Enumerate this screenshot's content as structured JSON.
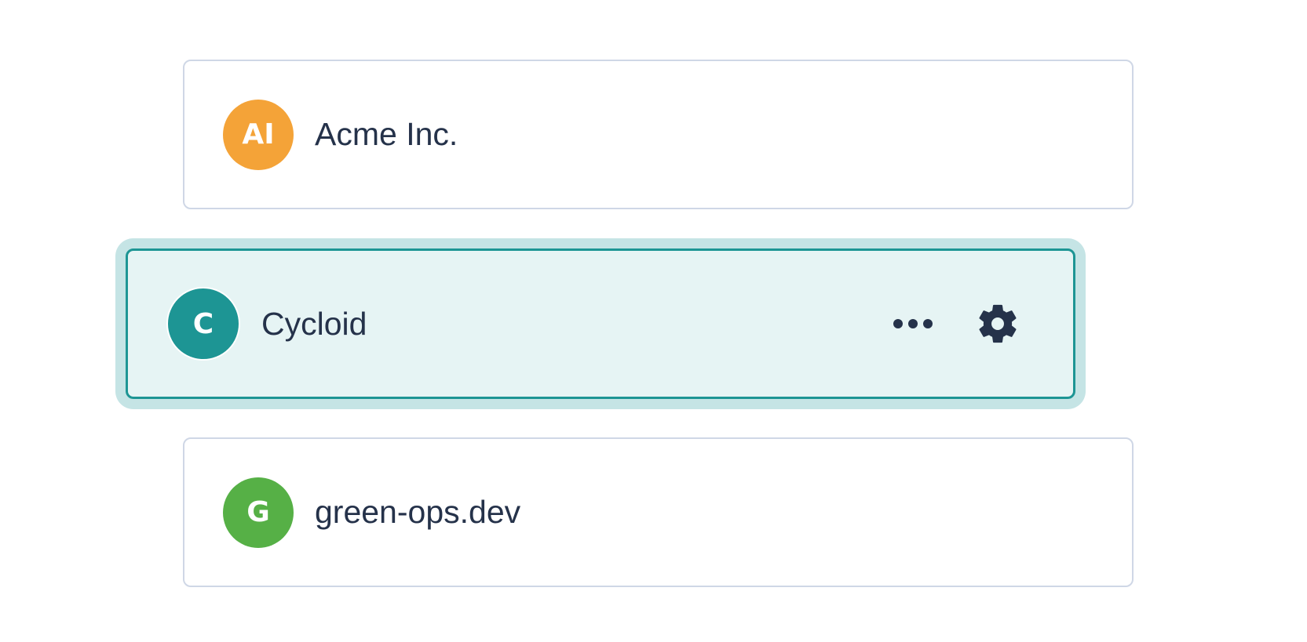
{
  "organizations": [
    {
      "name": "Acme Inc.",
      "initials": "AI",
      "avatar_color": "#f4a338",
      "selected": false
    },
    {
      "name": "Cycloid",
      "initials": "C",
      "avatar_color": "#1d9594",
      "selected": true,
      "actions": [
        {
          "icon": "more-horizontal-icon"
        },
        {
          "icon": "gear-icon"
        }
      ]
    },
    {
      "name": "green-ops.dev",
      "initials": "G",
      "avatar_color": "#56b046",
      "selected": false
    }
  ],
  "colors": {
    "text": "#25324a",
    "card_border": "#cfd7e6",
    "selected_border": "#1d9594",
    "selected_background": "#e6f4f4",
    "selected_halo": "#c5e4e5"
  }
}
